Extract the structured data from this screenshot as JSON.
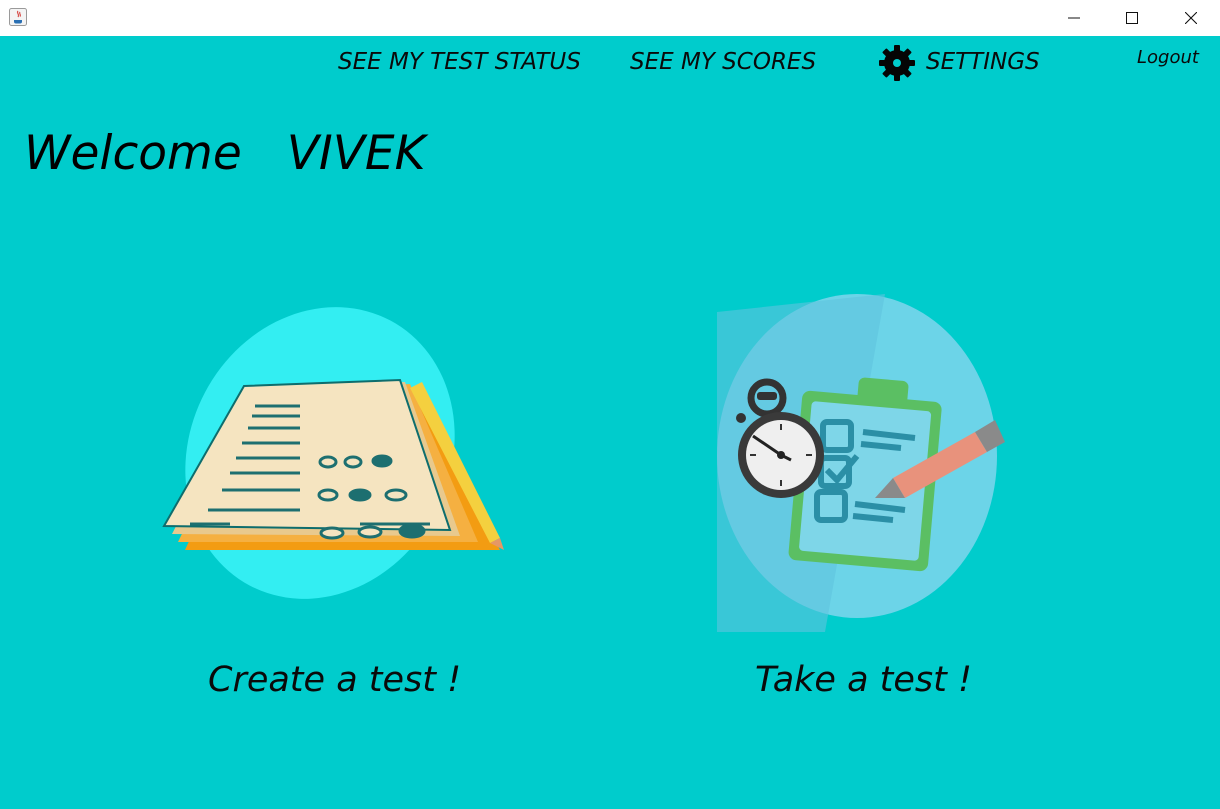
{
  "window": {
    "minimize_icon": "minimize-icon",
    "maximize_icon": "maximize-icon",
    "close_icon": "close-icon"
  },
  "nav": {
    "test_status": "SEE MY TEST STATUS",
    "scores": "SEE MY SCORES",
    "settings": "SETTINGS",
    "logout": "Logout"
  },
  "welcome": {
    "greeting": "Welcome",
    "name": "VIVEK"
  },
  "cards": {
    "create_label": "Create a test !",
    "take_label": "Take a test !"
  },
  "colors": {
    "background": "#00CCCC",
    "titlebar": "#FFFFFF",
    "text": "#000000"
  }
}
